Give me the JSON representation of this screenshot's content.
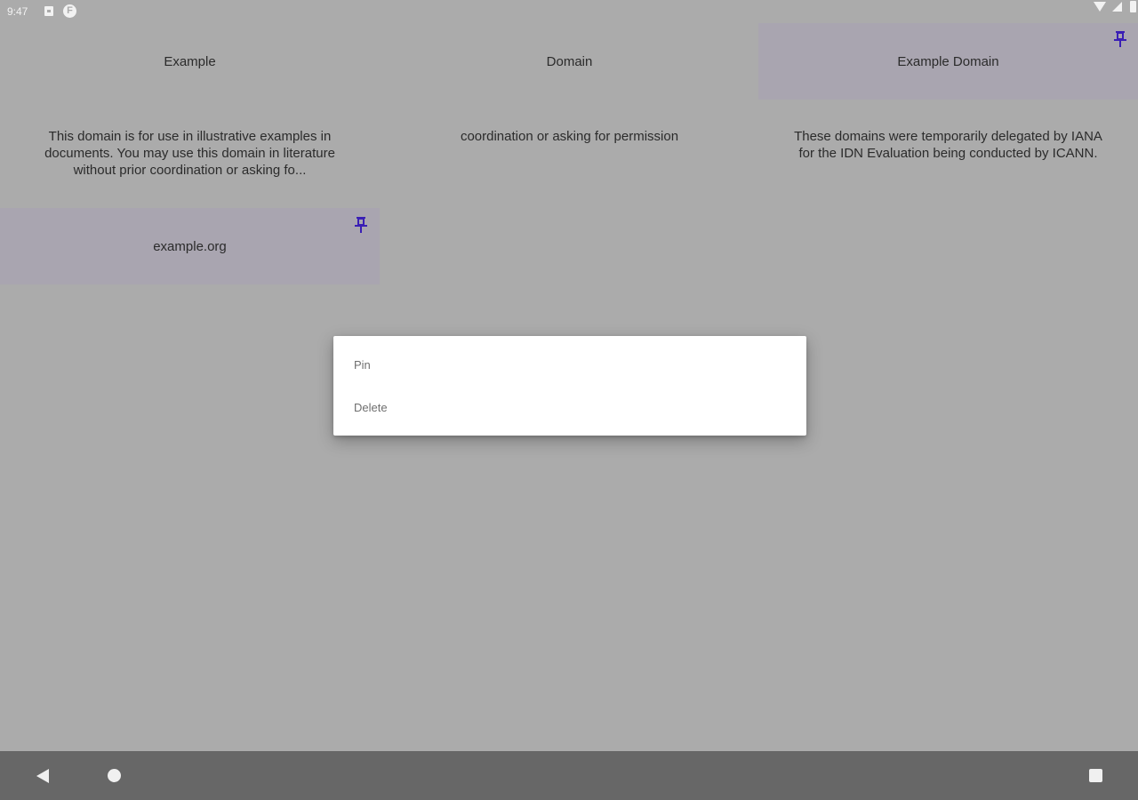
{
  "status_bar": {
    "time": "9:47",
    "left_icons": [
      "document-icon",
      "f-app-icon"
    ],
    "right_icons": [
      "wifi-icon",
      "signal-icon",
      "battery-icon"
    ]
  },
  "cards": [
    {
      "text": "Example",
      "pinned": false
    },
    {
      "text": "Domain",
      "pinned": false
    },
    {
      "text": "Example Domain",
      "pinned": true
    },
    {
      "text": "This domain is for use in illustrative examples in documents. You may use this domain in literature without prior coordination or asking fo...",
      "pinned": false
    },
    {
      "text": "coordination or asking for permission",
      "pinned": false
    },
    {
      "text": "These domains were temporarily delegated by IANA for the IDN Evaluation being conducted by ICANN.",
      "pinned": false
    },
    {
      "text": "example.org",
      "pinned": true
    }
  ],
  "context_menu": {
    "items": [
      "Pin",
      "Delete"
    ]
  },
  "nav_bar": {
    "icons": [
      "back-icon",
      "home-icon",
      "recents-icon"
    ]
  },
  "colors": {
    "scrim": "#ababab",
    "pinned_card": "#a9a5b0",
    "pin_accent": "#3a1fb5",
    "menu_bg": "#ffffff",
    "nav_bar": "#676767"
  }
}
